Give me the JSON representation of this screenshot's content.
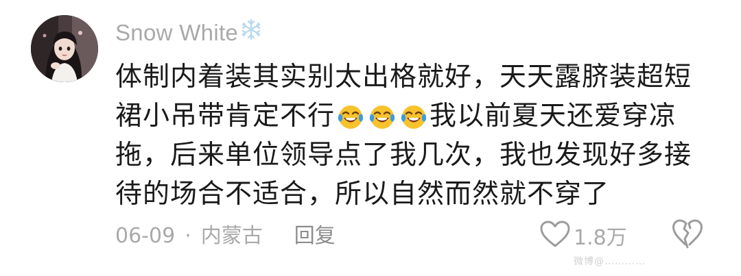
{
  "comment": {
    "username": "Snow White",
    "username_badge_icon": "snowflake-icon",
    "text_lines": [
      "体制内着装其实别太出格就好，天天露脐装超短",
      "裙小吊带肯定不行",
      "我以前夏天还爱穿凉",
      "拖，后来单位领导点了我几次，我也发现好多接",
      "待的场合不适合，所以自然而然就不穿了"
    ],
    "emoji": "laughing-crying-emoji",
    "emoji_count": 3,
    "date": "06-09",
    "separator": "·",
    "location": "内蒙古",
    "reply_label": "回复",
    "like_count": "1.8万",
    "like_icon": "heart-outline-icon",
    "dislike_icon": "broken-heart-icon"
  },
  "watermark": "微博@…………",
  "colors": {
    "text": "#1a1a1a",
    "muted": "#a9a9a9",
    "snowflake": "#b9d9ee",
    "emoji_face": "#f7c22c",
    "emoji_tears": "#3d9ce0"
  }
}
